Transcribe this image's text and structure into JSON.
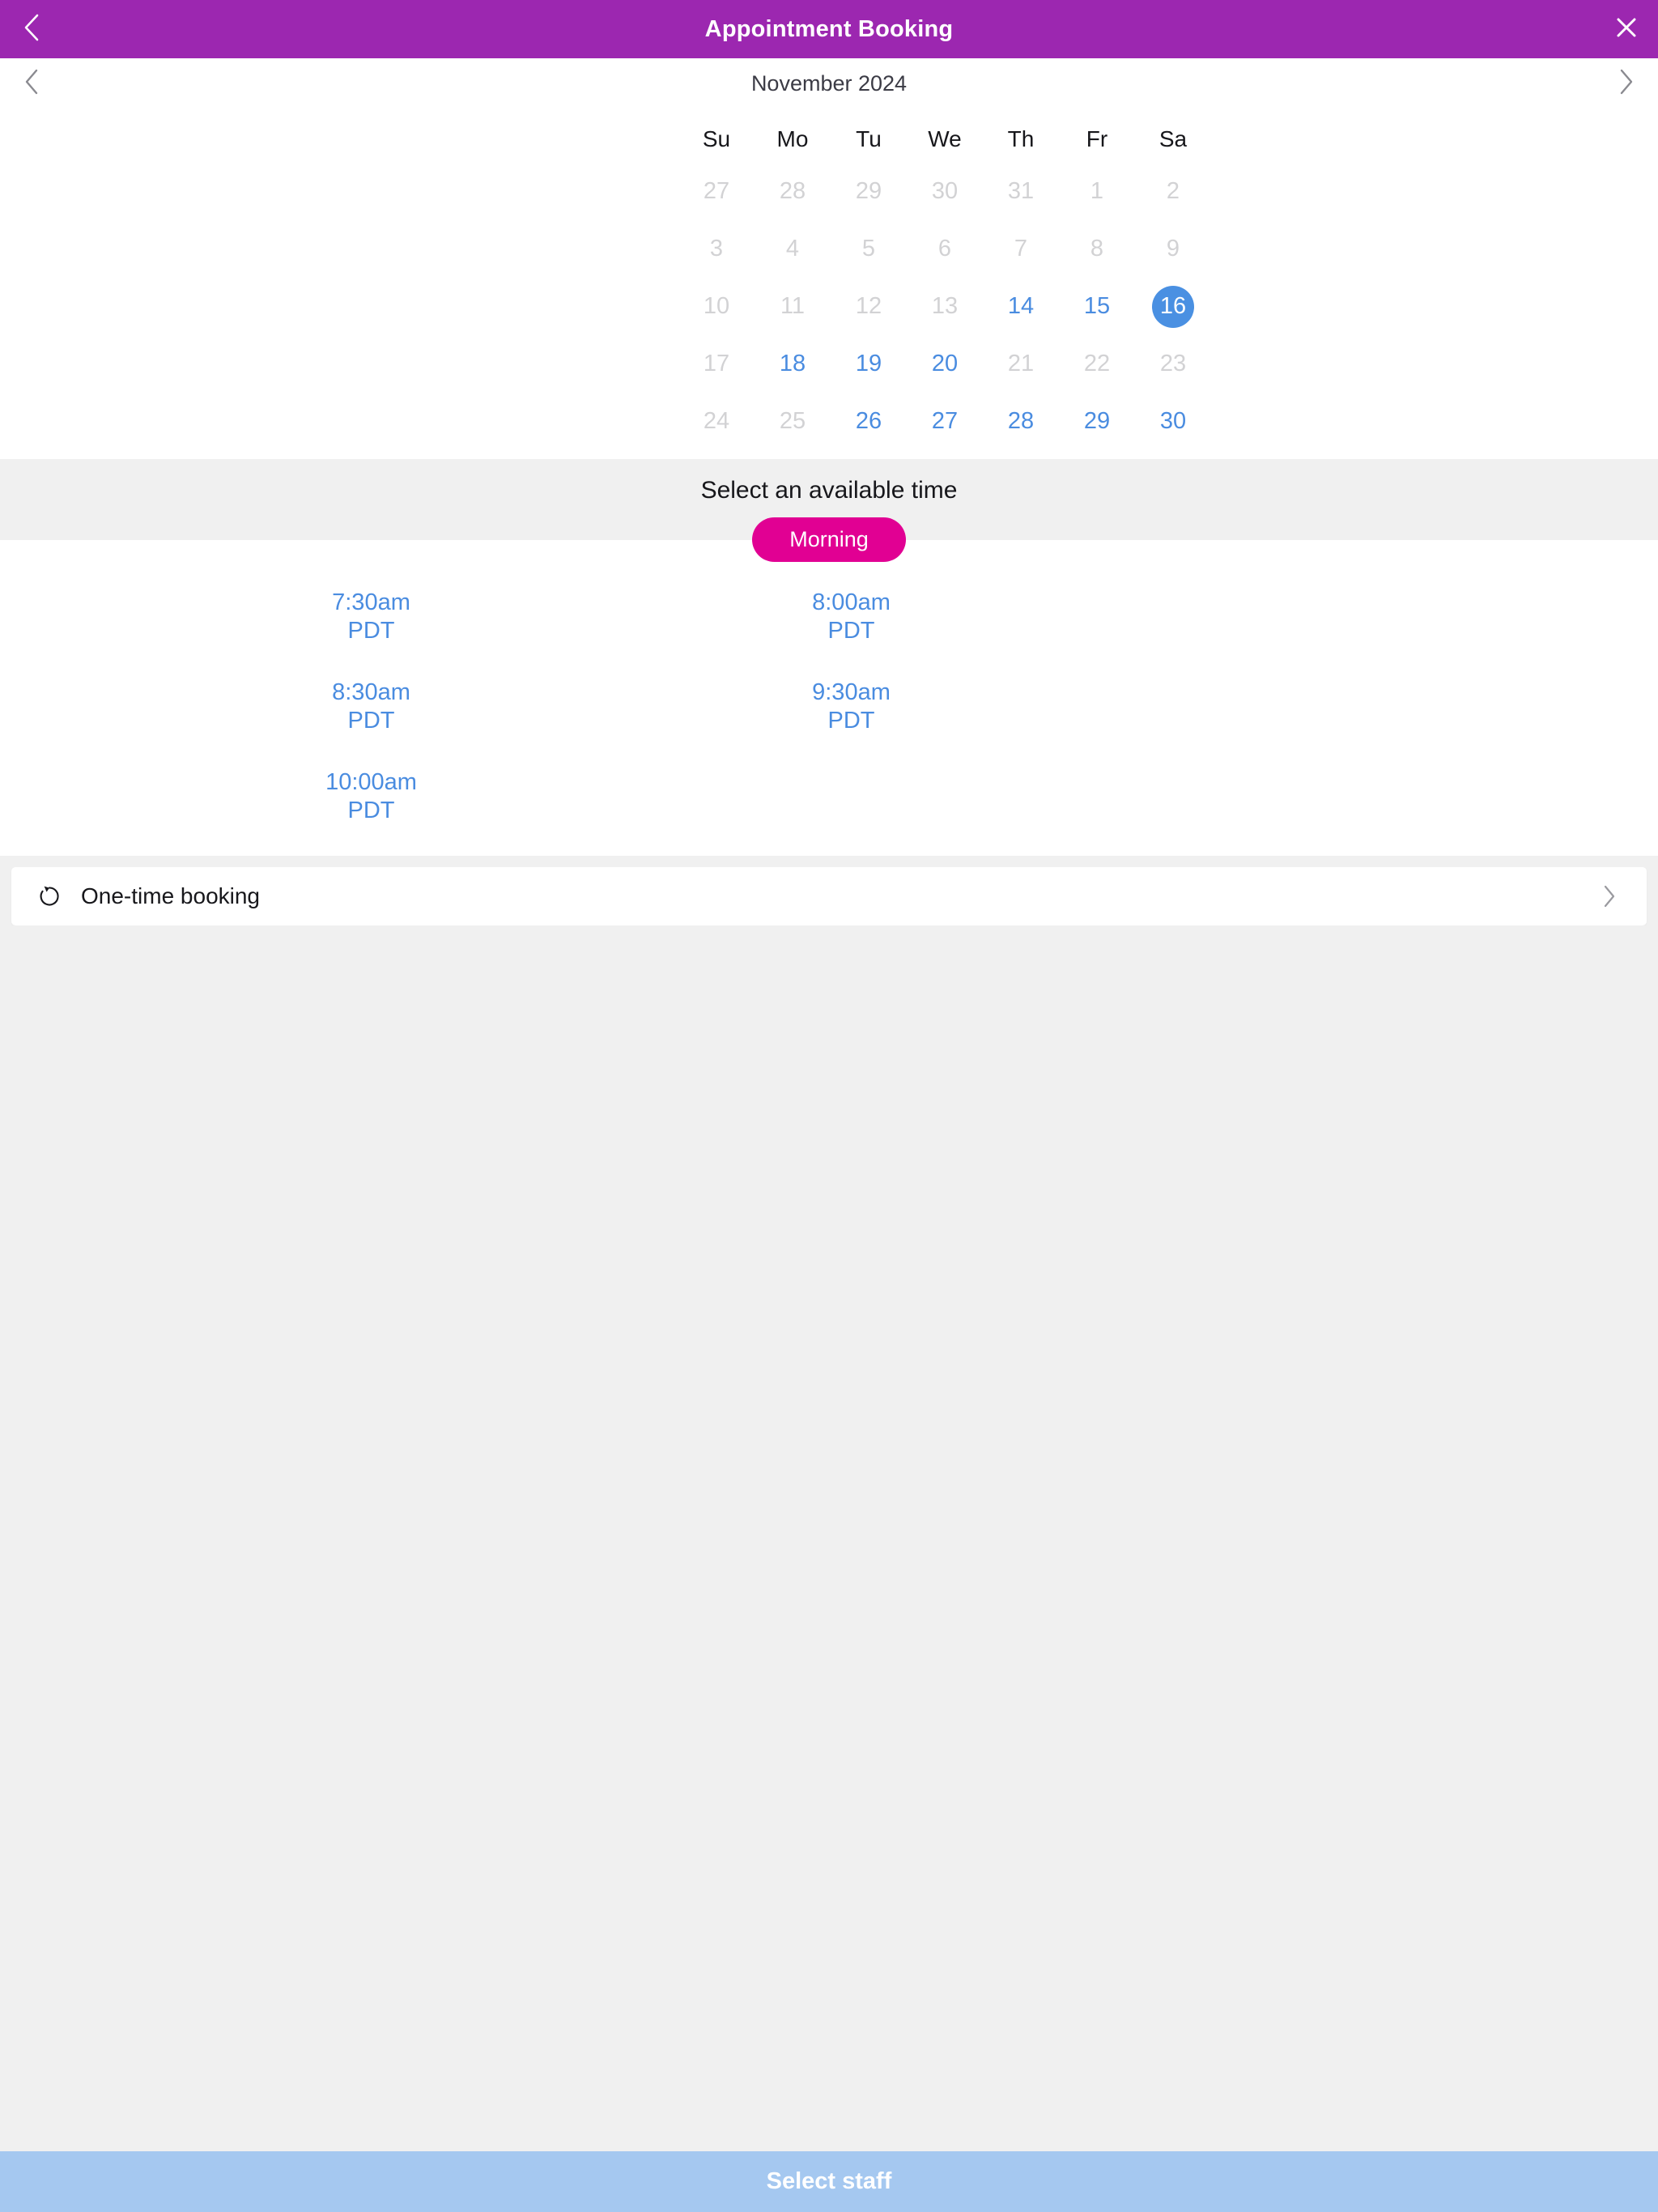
{
  "titlebar": {
    "title": "Appointment Booking",
    "back_icon": "chevron-left-icon",
    "close_icon": "close-icon"
  },
  "calendar": {
    "month_label": "November 2024",
    "prev_icon": "chevron-left-icon",
    "next_icon": "chevron-right-icon",
    "weekdays": [
      "Su",
      "Mo",
      "Tu",
      "We",
      "Th",
      "Fr",
      "Sa"
    ],
    "weeks": [
      [
        {
          "day": "27",
          "state": "muted"
        },
        {
          "day": "28",
          "state": "muted"
        },
        {
          "day": "29",
          "state": "muted"
        },
        {
          "day": "30",
          "state": "muted"
        },
        {
          "day": "31",
          "state": "muted"
        },
        {
          "day": "1",
          "state": "muted"
        },
        {
          "day": "2",
          "state": "muted"
        }
      ],
      [
        {
          "day": "3",
          "state": "muted"
        },
        {
          "day": "4",
          "state": "muted"
        },
        {
          "day": "5",
          "state": "muted"
        },
        {
          "day": "6",
          "state": "muted"
        },
        {
          "day": "7",
          "state": "muted"
        },
        {
          "day": "8",
          "state": "muted"
        },
        {
          "day": "9",
          "state": "muted"
        }
      ],
      [
        {
          "day": "10",
          "state": "muted"
        },
        {
          "day": "11",
          "state": "muted"
        },
        {
          "day": "12",
          "state": "muted"
        },
        {
          "day": "13",
          "state": "muted"
        },
        {
          "day": "14",
          "state": "enabled"
        },
        {
          "day": "15",
          "state": "enabled"
        },
        {
          "day": "16",
          "state": "selected"
        }
      ],
      [
        {
          "day": "17",
          "state": "muted"
        },
        {
          "day": "18",
          "state": "enabled"
        },
        {
          "day": "19",
          "state": "enabled"
        },
        {
          "day": "20",
          "state": "enabled"
        },
        {
          "day": "21",
          "state": "muted"
        },
        {
          "day": "22",
          "state": "muted"
        },
        {
          "day": "23",
          "state": "muted"
        }
      ],
      [
        {
          "day": "24",
          "state": "muted"
        },
        {
          "day": "25",
          "state": "muted"
        },
        {
          "day": "26",
          "state": "enabled"
        },
        {
          "day": "27",
          "state": "enabled"
        },
        {
          "day": "28",
          "state": "enabled"
        },
        {
          "day": "29",
          "state": "enabled"
        },
        {
          "day": "30",
          "state": "enabled"
        }
      ]
    ]
  },
  "time_section": {
    "title": "Select an available time",
    "period_label": "Morning",
    "slots": [
      {
        "time": "7:30am",
        "tz": "PDT"
      },
      {
        "time": "8:00am",
        "tz": "PDT"
      },
      {
        "time": "8:30am",
        "tz": "PDT"
      },
      {
        "time": "9:30am",
        "tz": "PDT"
      },
      {
        "time": "10:00am",
        "tz": "PDT"
      }
    ]
  },
  "option_row": {
    "label": "One-time booking",
    "icon": "repeat-icon",
    "chevron_icon": "chevron-right-icon"
  },
  "cta": {
    "label": "Select staff"
  },
  "colors": {
    "header_purple": "#9c27b0",
    "accent_blue": "#4a90e2",
    "link_blue": "#4a8ce0",
    "period_pink": "#e10093",
    "cta_blue": "#a5c8f0",
    "band_gray": "#f0f0f0",
    "muted_gray": "#d2d2d4"
  }
}
